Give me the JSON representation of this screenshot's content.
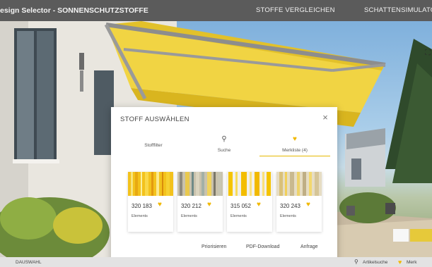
{
  "header": {
    "app_title": "esign Selector - SONNENSCHUTZSTOFFE",
    "nav": [
      {
        "label": "STOFFE VERGLEICHEN"
      },
      {
        "label": "SCHATTENSIMULATO"
      }
    ]
  },
  "scene": {
    "expand_icon": "expand-icon"
  },
  "modal": {
    "title": "STOFF AUSWÄHLEN",
    "close": "×",
    "tabs": [
      {
        "label": "Stofffilter",
        "icon": "",
        "active": false
      },
      {
        "label": "Suche",
        "icon": "search-icon",
        "active": false
      },
      {
        "label": "Merkliste (4)",
        "icon": "heart-icon",
        "active": true
      }
    ],
    "fabrics": [
      {
        "code": "320 183",
        "collection": "Elements"
      },
      {
        "code": "320 212",
        "collection": "Elements"
      },
      {
        "code": "315 052",
        "collection": "Elements"
      },
      {
        "code": "320 243",
        "collection": "Elements"
      }
    ],
    "actions": [
      "Priorisieren",
      "PDF-Download",
      "Anfrage"
    ]
  },
  "footer": {
    "left_label": "DAUSWAHL",
    "article_label": "Artikelsuche",
    "watchlist_label": "Merk"
  },
  "colors": {
    "accent": "#f1b800",
    "topbar": "#5b5b5b"
  }
}
